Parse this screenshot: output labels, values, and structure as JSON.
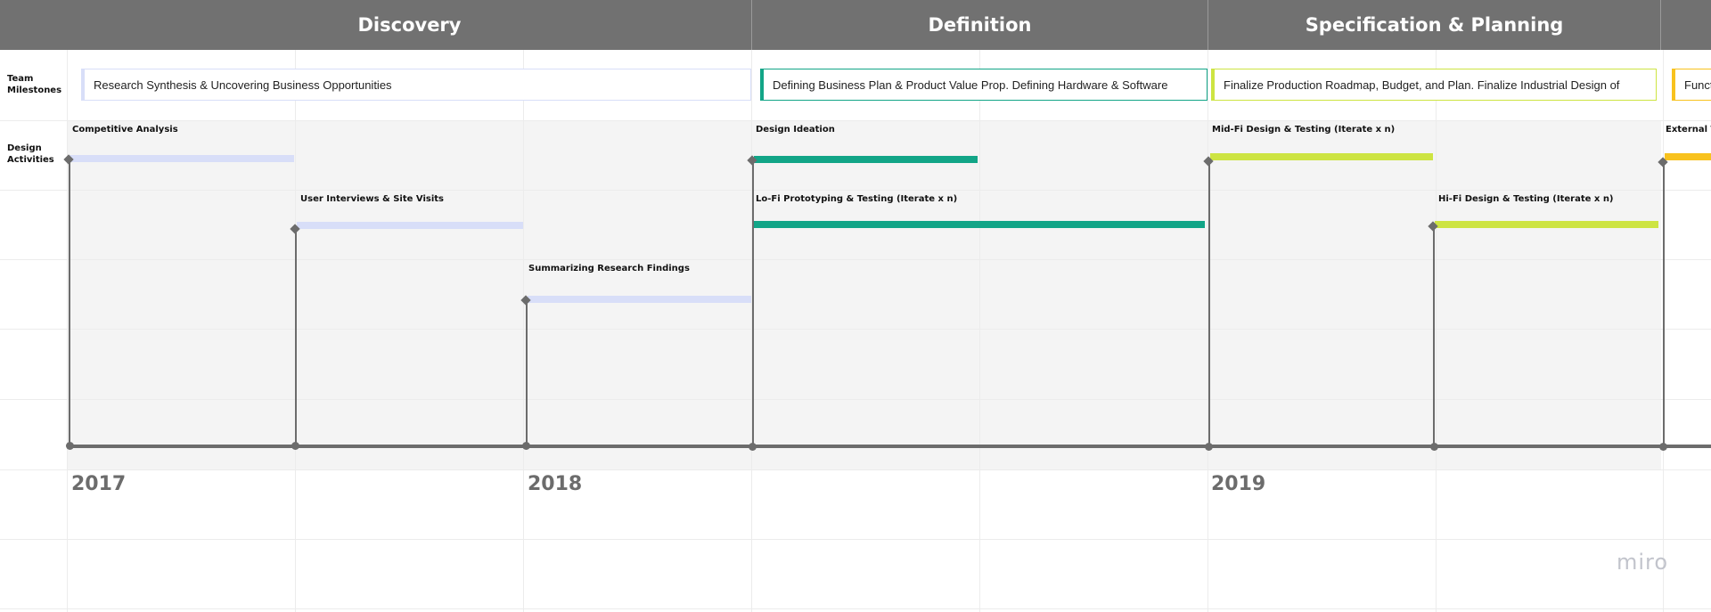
{
  "phases": [
    {
      "name": "Discovery"
    },
    {
      "name": "Definition"
    },
    {
      "name": "Specification & Planning"
    },
    {
      "name": ""
    }
  ],
  "row_labels": {
    "milestones": "Team Milestones",
    "activities": "Design Activities"
  },
  "milestones": [
    {
      "text": "Research Synthesis & Uncovering Business Opportunities",
      "color": "#d8def8"
    },
    {
      "text": "Defining Business Plan & Product Value Prop. Defining Hardware & Software",
      "color": "#12a587"
    },
    {
      "text": "Finalize Production Roadmap, Budget, and Plan. Finalize Industrial Design of",
      "color": "#cde442"
    },
    {
      "text": "Funct",
      "color": "#f8c21e"
    }
  ],
  "activities": [
    {
      "label": "Competitive Analysis",
      "color": "#d8def8"
    },
    {
      "label": "User Interviews & Site Visits",
      "color": "#d8def8"
    },
    {
      "label": "Summarizing Research Findings",
      "color": "#d8def8"
    },
    {
      "label": "Design Ideation",
      "color": "#12a587"
    },
    {
      "label": "Lo-Fi Prototyping & Testing (Iterate x n)",
      "color": "#12a587"
    },
    {
      "label": "Mid-Fi Design & Testing (Iterate x n)",
      "color": "#cde442"
    },
    {
      "label": "Hi-Fi Design & Testing (Iterate x n)",
      "color": "#cde442"
    },
    {
      "label": "External Te",
      "color": "#f8c21e"
    }
  ],
  "years": [
    "2017",
    "2018",
    "2019"
  ],
  "logo_text": "miro",
  "colors": {
    "header": "#717171",
    "axis": "#6c6c6c",
    "discovery": "#d8def8",
    "definition": "#12a587",
    "specification": "#cde442",
    "next_phase": "#f8c21e"
  }
}
